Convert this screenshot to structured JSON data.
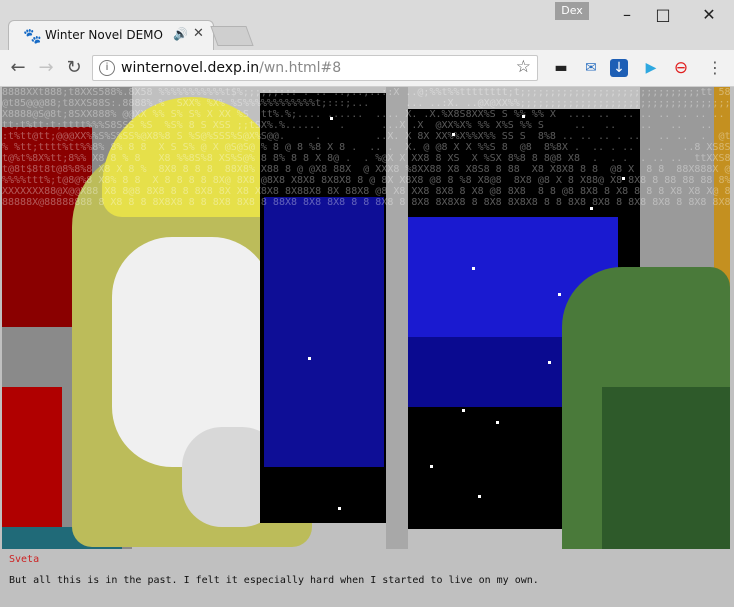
{
  "browser": {
    "tab_title": "Winter Novel DEMO",
    "tab_icon": "winter-novel-favicon",
    "profile_name": "Dex",
    "url_host": "winternovel.dexp.in",
    "url_path": "/wn.html#8"
  },
  "novel": {
    "speaker": "Sveta",
    "text": "But all this is in the past. I felt it especially hard when I started to live on my own.",
    "colors": {
      "night_sky": "#000000",
      "window_blue": "#0000cc",
      "hair_yellow": "#e8e040",
      "wall_red": "#aa0000",
      "plant_green": "#5a8a4a",
      "skin_white": "#f4f4f4",
      "dialog_bg": "#c0c0c0"
    }
  }
}
